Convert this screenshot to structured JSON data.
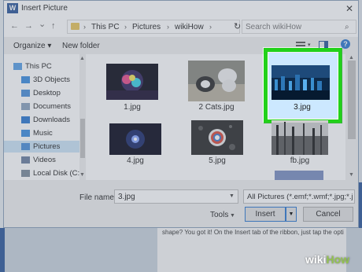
{
  "background": {
    "doc_text": "shape? You got it! On the Insert tab of the ribbon, just tap the opti"
  },
  "dialog": {
    "title": "Insert Picture",
    "app_icon_letter": "W",
    "close_glyph": "✕"
  },
  "address": {
    "back": "←",
    "forward": "→",
    "dropdown": "⌄",
    "up": "↑",
    "crumbs": [
      "This PC",
      "Pictures",
      "wikiHow"
    ],
    "separator": "›",
    "refresh": "↻",
    "search_placeholder": "Search wikiHow",
    "search_icon": "search-icon"
  },
  "toolbar": {
    "organize": "Organize ▾",
    "new_folder": "New folder",
    "help": "?"
  },
  "sidebar": {
    "items": [
      {
        "label": "This PC",
        "icon": "computer-icon",
        "color": "#5aa0e6"
      },
      {
        "label": "3D Objects",
        "icon": "cube-icon",
        "color": "#3c8de0"
      },
      {
        "label": "Desktop",
        "icon": "desktop-icon",
        "color": "#4a8fd8"
      },
      {
        "label": "Documents",
        "icon": "document-icon",
        "color": "#8aa3bd"
      },
      {
        "label": "Downloads",
        "icon": "download-icon",
        "color": "#2b78d0"
      },
      {
        "label": "Music",
        "icon": "music-icon",
        "color": "#3c8de0"
      },
      {
        "label": "Pictures",
        "icon": "pictures-icon",
        "color": "#4a8fd8"
      },
      {
        "label": "Videos",
        "icon": "video-icon",
        "color": "#6a7fa0"
      },
      {
        "label": "Local Disk (C:)",
        "icon": "drive-icon",
        "color": "#7a8a9a"
      }
    ],
    "selected_index": 6
  },
  "files": [
    {
      "name": "1.jpg"
    },
    {
      "name": "2 Cats.jpg"
    },
    {
      "name": "3.jpg"
    },
    {
      "name": "4.jpg"
    },
    {
      "name": "5.jpg"
    },
    {
      "name": "fb.jpg"
    }
  ],
  "bottom": {
    "filename_label": "File name:",
    "filename_value": "3.jpg",
    "filter": "All Pictures (*.emf;*.wmf;*.jpg;*.j",
    "tools": "Tools",
    "insert": "Insert",
    "cancel": "Cancel",
    "dropdown": "▼"
  },
  "watermark": {
    "prefix": "wiki",
    "suffix": "How"
  },
  "colors": {
    "highlight": "#22d11a",
    "accent": "#2b78d0"
  }
}
